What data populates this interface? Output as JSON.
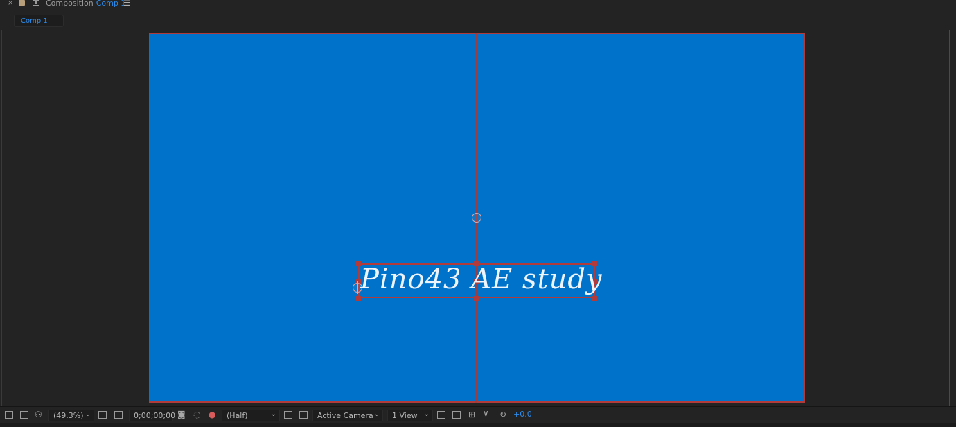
{
  "header": {
    "close_symbol": "×",
    "label": "Composition",
    "comp_name": "Comp 1",
    "menu_symbol": "☰"
  },
  "tabs": [
    {
      "label": "Comp 1"
    }
  ],
  "canvas": {
    "background_color": "#0072c9",
    "guide_color": "#b13a3a",
    "text_layer": "Pino43 AE study"
  },
  "toolbar": {
    "magnification": "(49.3%)",
    "timecode": "0;00;00;00",
    "resolution": "(Half)",
    "camera": "Active Camera",
    "views": "1 View",
    "exposure": "+0.0"
  },
  "icons": {
    "always_preview": "preview-icon",
    "monitor": "monitor-icon",
    "mask": "mask-visibility-icon",
    "region": "region-of-interest-icon",
    "transparency": "transparency-grid-icon",
    "snapshot": "camera-icon",
    "show_snapshot": "show-snapshot-icon",
    "channel": "color-channel-icon",
    "fast_previews": "fast-previews-icon",
    "toggle_grid": "grid-icon",
    "reset_exposure": "reset-exposure-icon"
  }
}
